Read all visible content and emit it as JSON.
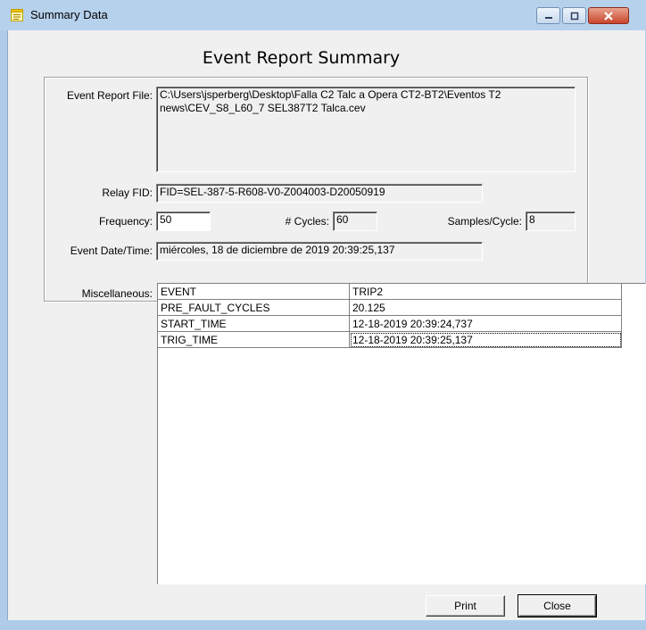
{
  "window": {
    "title": "Summary Data",
    "app_icon": "notepad-icon",
    "controls": [
      "minimize-icon",
      "maximize-icon",
      "close-icon"
    ]
  },
  "heading": "Event Report Summary",
  "fields": {
    "event_report_file": {
      "label": "Event Report File:",
      "value": "C:\\Users\\jsperberg\\Desktop\\Falla C2 Talc a Opera CT2-BT2\\Eventos T2 news\\CEV_S8_L60_7 SEL387T2 Talca.cev"
    },
    "relay_fid": {
      "label": "Relay FID:",
      "value": "FID=SEL-387-5-R608-V0-Z004003-D20050919"
    },
    "frequency": {
      "label": "Frequency:",
      "value": "50"
    },
    "cycles": {
      "label": "# Cycles:",
      "value": "60"
    },
    "samples_per_cycle": {
      "label": "Samples/Cycle:",
      "value": "8"
    },
    "event_datetime": {
      "label": "Event Date/Time:",
      "value": "miércoles, 18 de diciembre de 2019  20:39:25,137"
    }
  },
  "miscellaneous": {
    "label": "Miscellaneous:",
    "rows": [
      {
        "key": "EVENT",
        "value": "TRIP2"
      },
      {
        "key": "PRE_FAULT_CYCLES",
        "value": "20.125"
      },
      {
        "key": "START_TIME",
        "value": "12-18-2019 20:39:24,737"
      },
      {
        "key": "TRIG_TIME",
        "value": "12-18-2019 20:39:25,137"
      }
    ]
  },
  "buttons": {
    "print": "Print",
    "close": "Close"
  },
  "colors": {
    "frame": "#aeccea",
    "client": "#f0f0f0",
    "close_button": "#c9442a"
  }
}
